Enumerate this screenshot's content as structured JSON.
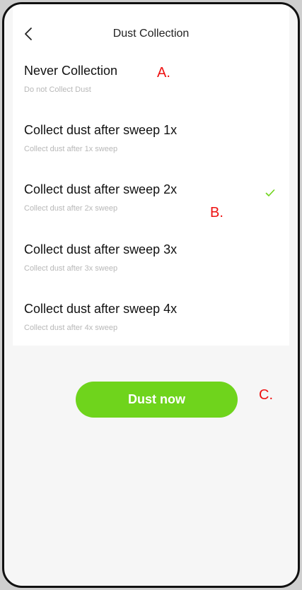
{
  "header": {
    "title": "Dust Collection"
  },
  "options": [
    {
      "title": "Never Collection",
      "subtitle": "Do not Collect Dust",
      "selected": false
    },
    {
      "title": "Collect dust after sweep 1x",
      "subtitle": "Collect dust after 1x sweep",
      "selected": false
    },
    {
      "title": "Collect dust after sweep 2x",
      "subtitle": "Collect dust after 2x sweep",
      "selected": true
    },
    {
      "title": "Collect dust after sweep 3x",
      "subtitle": "Collect dust after 3x sweep",
      "selected": false
    },
    {
      "title": "Collect dust after sweep 4x",
      "subtitle": "Collect dust after 4x sweep",
      "selected": false
    }
  ],
  "action": {
    "label": "Dust now"
  },
  "annotations": {
    "a": "A.",
    "b": "B.",
    "c": "C."
  },
  "icons": {
    "back": "chevron-left-icon",
    "selected": "check-icon"
  },
  "colors": {
    "accent": "#6fd41c",
    "annotation": "#ee1111",
    "frame": "#111111"
  }
}
